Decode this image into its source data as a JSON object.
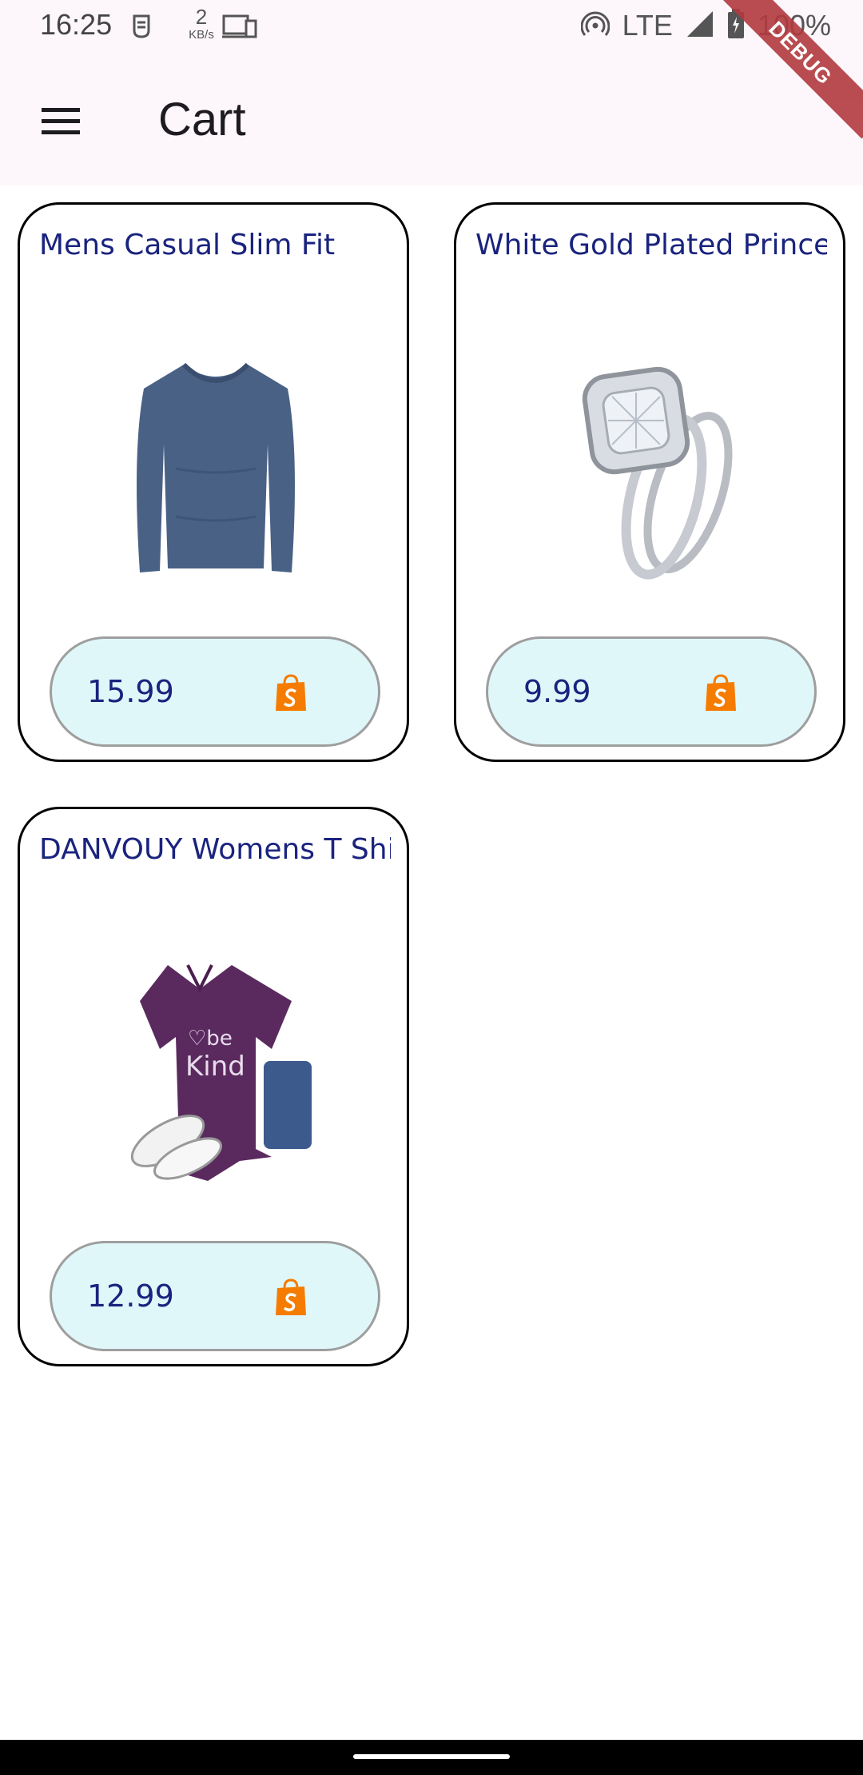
{
  "status_bar": {
    "time": "16:25",
    "netspeed_value": "2",
    "netspeed_unit": "KB/s",
    "network": "LTE",
    "battery": "100%"
  },
  "app_bar": {
    "title": "Cart",
    "menu_icon": "hamburger-menu-icon"
  },
  "debug_banner": "DEBUG",
  "cart_items": [
    {
      "title": "Mens Casual Slim Fit",
      "price": "15.99",
      "image": "blue-long-sleeve-shirt",
      "icon": "shopify-bag-icon"
    },
    {
      "title": "White Gold Plated Princess",
      "price": "9.99",
      "image": "diamond-ring-set",
      "icon": "shopify-bag-icon"
    },
    {
      "title": "DANVOUY Womens T Shirt Casual Cotton Short",
      "price": "12.99",
      "image": "purple-be-kind-tshirt",
      "icon": "shopify-bag-icon"
    }
  ],
  "colors": {
    "title_text": "#1a237e",
    "pill_bg": "#e0f7fa",
    "shop_icon": "#f57c00",
    "app_bar_bg": "#fdf7fb"
  }
}
